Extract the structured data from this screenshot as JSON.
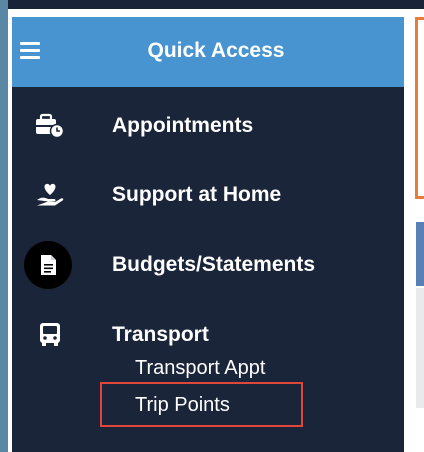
{
  "header": {
    "title": "Quick Access"
  },
  "menu": [
    {
      "label": "Appointments",
      "icon": "briefcase-clock-icon"
    },
    {
      "label": "Support at Home",
      "icon": "hand-heart-icon"
    },
    {
      "label": "Budgets/Statements",
      "icon": "document-icon"
    },
    {
      "label": "Transport",
      "icon": "bus-icon",
      "subitems": [
        {
          "label": "Transport Appt"
        },
        {
          "label": "Trip Points"
        }
      ]
    }
  ],
  "colors": {
    "header": "#4794d1",
    "sidebar": "#1b253a",
    "highlight": "#e0473a",
    "accent": "#e77d3a"
  }
}
